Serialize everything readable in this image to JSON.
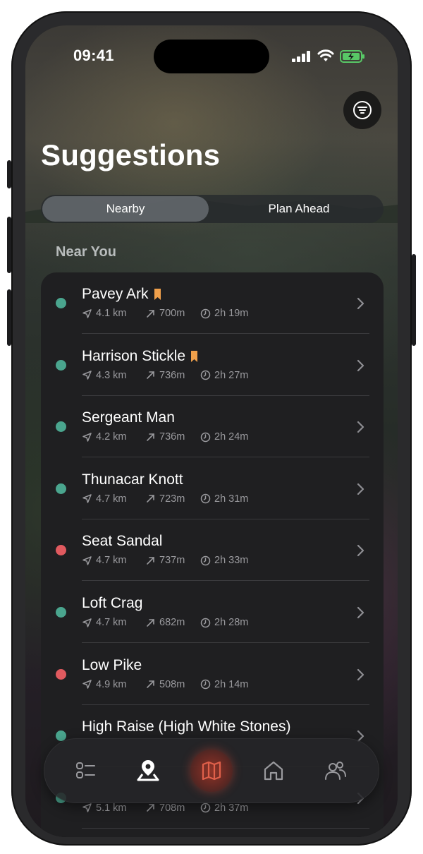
{
  "status": {
    "time": "09:41"
  },
  "header": {
    "title": "Suggestions",
    "filter_icon": "filter-lines-icon"
  },
  "segments": {
    "active": "Nearby",
    "inactive": "Plan Ahead"
  },
  "section": {
    "label": "Near You"
  },
  "colors": {
    "green": "#4aa58e",
    "red": "#e05a5f",
    "bookmark": "#f0a04b",
    "tab_active": "#e0604a"
  },
  "items": [
    {
      "name": "Pavey Ark",
      "bookmarked": true,
      "status": "green",
      "distance": "4.1 km",
      "elevation": "700m",
      "duration": "2h 19m"
    },
    {
      "name": "Harrison Stickle",
      "bookmarked": true,
      "status": "green",
      "distance": "4.3 km",
      "elevation": "736m",
      "duration": "2h 27m"
    },
    {
      "name": "Sergeant Man",
      "bookmarked": false,
      "status": "green",
      "distance": "4.2 km",
      "elevation": "736m",
      "duration": "2h 24m"
    },
    {
      "name": "Thunacar Knott",
      "bookmarked": false,
      "status": "green",
      "distance": "4.7 km",
      "elevation": "723m",
      "duration": "2h 31m"
    },
    {
      "name": "Seat Sandal",
      "bookmarked": false,
      "status": "red",
      "distance": "4.7 km",
      "elevation": "737m",
      "duration": "2h 33m"
    },
    {
      "name": "Loft Crag",
      "bookmarked": false,
      "status": "green",
      "distance": "4.7 km",
      "elevation": "682m",
      "duration": "2h 28m"
    },
    {
      "name": "Low Pike",
      "bookmarked": false,
      "status": "red",
      "distance": "4.9 km",
      "elevation": "508m",
      "duration": "2h 14m"
    },
    {
      "name": "High Raise (High White Stones)",
      "bookmarked": false,
      "status": "green",
      "distance": "",
      "elevation": "",
      "duration": ""
    },
    {
      "name": "",
      "bookmarked": false,
      "status": "green",
      "distance": "5.1 km",
      "elevation": "708m",
      "duration": "2h 37m"
    }
  ],
  "tabbar": {
    "tabs": [
      {
        "icon": "checklist-icon",
        "active": false
      },
      {
        "icon": "location-pin-icon",
        "active": false
      },
      {
        "icon": "map-icon",
        "active": true
      },
      {
        "icon": "home-icon",
        "active": false
      },
      {
        "icon": "people-icon",
        "active": false
      }
    ]
  }
}
